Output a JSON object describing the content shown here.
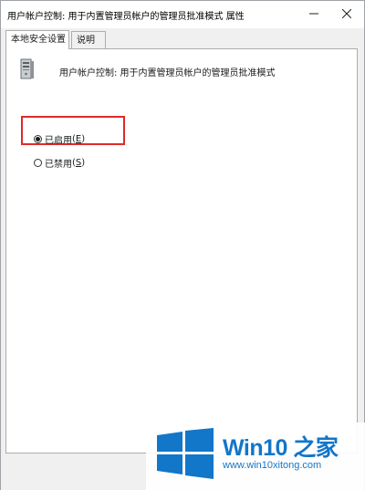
{
  "window": {
    "title": "用户帐户控制: 用于内置管理员帐户的管理员批准模式 属性",
    "minimize_icon": "minimize-icon",
    "close_icon": "close-icon"
  },
  "tabs": [
    {
      "label": "本地安全设置",
      "active": true
    },
    {
      "label": "说明",
      "active": false
    }
  ],
  "policy": {
    "icon": "server-icon",
    "title": "用户帐户控制: 用于内置管理员帐户的管理员批准模式"
  },
  "options": [
    {
      "label": "已启用",
      "accel": "E",
      "checked": true
    },
    {
      "label": "已禁用",
      "accel": "S",
      "checked": false
    }
  ],
  "highlight_color": "#e0292a",
  "watermark": {
    "brand": "Win10 之家",
    "url": "www.win10xitong.com",
    "color": "#1276c9"
  }
}
